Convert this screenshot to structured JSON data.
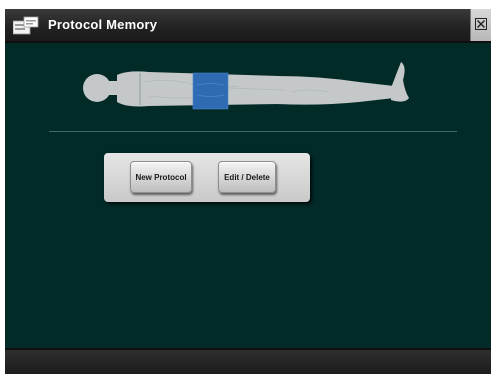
{
  "window": {
    "title": "Protocol Memory",
    "app_icon": "protocol-memory-icon",
    "close_icon": "close-icon"
  },
  "body_diagram": {
    "icon": "human-body-icon",
    "highlight_region": "abdomen",
    "highlight_color": "#2f6bb3"
  },
  "panel": {
    "new_protocol_label": "New Protocol",
    "edit_delete_label": "Edit / Delete"
  },
  "colors": {
    "background": "#022a27",
    "titlebar": "#2a2a2a",
    "panel": "#d6d6d6"
  }
}
